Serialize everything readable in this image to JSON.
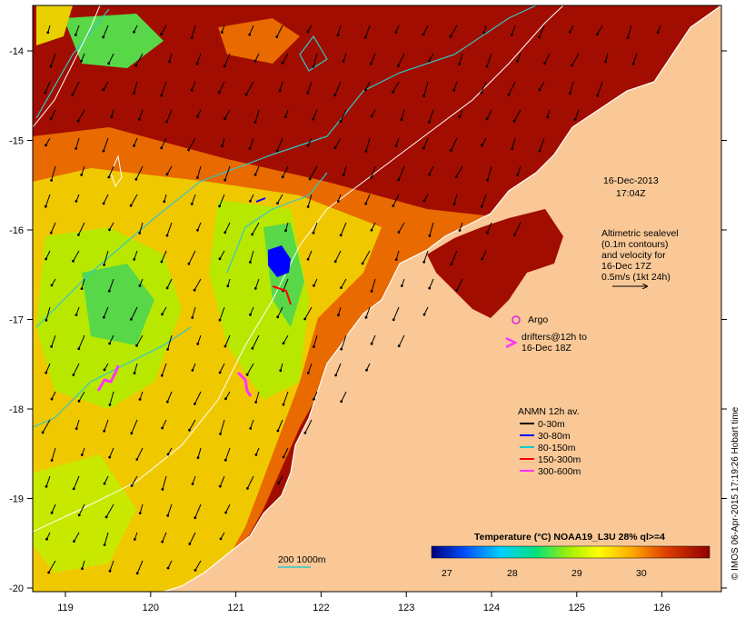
{
  "map": {
    "date_label": "16-Dec-2013",
    "time_label": "17:04Z",
    "altimetry_note": [
      "Altimetric sealevel",
      "(0.1m contours)",
      "and velocity for",
      "16-Dec 17Z",
      "0.5m/s (1kt 24h)"
    ],
    "argo_label": "Argo",
    "drifter_label": [
      "drifters@12h to",
      "16-Dec 18Z"
    ],
    "mooring_legend": {
      "title": "ANMN 12h av.",
      "items": [
        {
          "label": "0-30m",
          "color": "#000000"
        },
        {
          "label": "30-80m",
          "color": "#0000ff"
        },
        {
          "label": "80-150m",
          "color": "#00cccc"
        },
        {
          "label": "150-300m",
          "color": "#ff0000"
        },
        {
          "label": "300-600m",
          "color": "#ff33ff"
        }
      ]
    },
    "isobath_label": "200  1000m",
    "colorbar": {
      "title": "Temperature (°C) NOAA19_L3U 28% ql>=4",
      "ticks": [
        "27",
        "28",
        "29",
        "30"
      ]
    },
    "x_ticks": [
      "119",
      "120",
      "121",
      "122",
      "123",
      "124",
      "125",
      "126"
    ],
    "y_ticks": [
      "-14",
      "-15",
      "-16",
      "-17",
      "-18",
      "-19",
      "-20"
    ],
    "credit": "© IMOS 06-Apr-2015 17:19:26 Hobart time",
    "colors": {
      "land": "#f9c896",
      "sst_warm": "#a10d00",
      "sst_mid": "#ffd000",
      "sst_cool": "#48d848",
      "contour": "#30c8c8",
      "isobath": "#ffffff",
      "argo": "#e020e0"
    }
  }
}
